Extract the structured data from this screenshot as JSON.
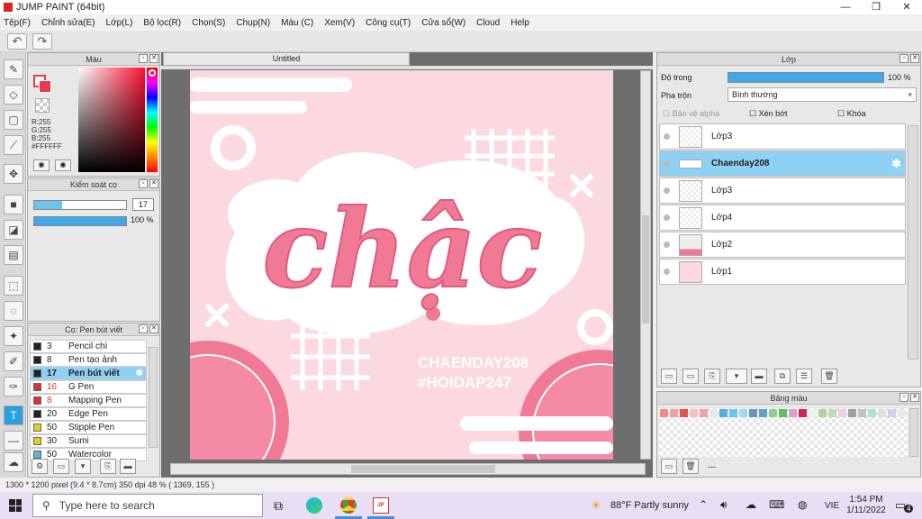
{
  "app": {
    "title": "JUMP PAINT (64bit)"
  },
  "window_controls": {
    "minimize": "—",
    "maximize": "❐",
    "close": "✕"
  },
  "menu": [
    "Tệp(F)",
    "Chỉnh sửa(E)",
    "Lớp(L)",
    "Bộ lọc(R)",
    "Chọn(S)",
    "Chụp(N)",
    "Màu (C)",
    "Xem(V)",
    "Công cụ(T)",
    "Cửa sổ(W)",
    "Cloud",
    "Help"
  ],
  "toolbar": {
    "undo": "↶",
    "redo": "↷"
  },
  "color_panel": {
    "title": "Màu",
    "r": "R:255",
    "g": "G:255",
    "b": "B:255",
    "hex": "#FFFFFF"
  },
  "brush_control": {
    "title": "Kiểm soát cọ",
    "size": "17",
    "opacity": "100 %",
    "size_fill": 0.3,
    "opacity_fill": 1.0
  },
  "brush_list": {
    "title": "Cọ: Pen bút viết",
    "items": [
      {
        "num": "3",
        "name": "Pencil chì",
        "color": "#222222"
      },
      {
        "num": "8",
        "name": "Pen tạo ảnh",
        "color": "#222222"
      },
      {
        "num": "17",
        "name": "Pen bút viết",
        "color": "#222222"
      },
      {
        "num": "16",
        "name": "G Pen",
        "color": "#e03030"
      },
      {
        "num": "8",
        "name": "Mapping Pen",
        "color": "#e03030"
      },
      {
        "num": "20",
        "name": "Edge Pen",
        "color": "#222222"
      },
      {
        "num": "50",
        "name": "Stipple Pen",
        "color": "#e0d020"
      },
      {
        "num": "30",
        "name": "Sumi",
        "color": "#e0d020"
      },
      {
        "num": "50",
        "name": "Watercolor",
        "color": "#60b0e0"
      }
    ]
  },
  "canvas": {
    "tab": "Untitled",
    "word": "chậc",
    "watermark1": "CHAENDAY208",
    "watermark2": "#HOIDAP247"
  },
  "layer_panel": {
    "title": "Lớp",
    "opacity_label": "Độ trong",
    "opacity_value": "100 %",
    "opacity_fill": 1.0,
    "blend_label": "Pha trộn",
    "blend_value": "Bình thường",
    "protect_alpha": "Bảo vệ alpha",
    "clip": "Xén bớt",
    "lock": "Khóa",
    "layers": [
      {
        "name": "Lớp3"
      },
      {
        "name": "Chaenday208"
      },
      {
        "name": "Lớp3"
      },
      {
        "name": "Lớp4"
      },
      {
        "name": "Lớp2"
      },
      {
        "name": "Lớp1"
      }
    ]
  },
  "swatch_panel": {
    "title": "Bảng màu",
    "dashes": "---",
    "colors": [
      "#f28a8a",
      "#f4a0a0",
      "#e85050",
      "#f5c2c2",
      "#f0a0b0",
      "#e8e8e8",
      "#50b0e0",
      "#70c0f0",
      "#a0d8f0",
      "#7090c0",
      "#60a0d0",
      "#8fd08f",
      "#60c060",
      "#e0a0c0",
      "#d02060",
      "#f0f0f0",
      "#b0d0a0",
      "#c0e0b0",
      "#f0d0e0",
      "#a0a0a0",
      "#c0c0c0",
      "#b0e0d0",
      "#e0e0e0",
      "#d0d0f0",
      "#e8e8e8"
    ]
  },
  "status": {
    "text": "1300 * 1200 pixel   (9.4 * 8.7cm)   350 dpi   48 %   ( 1369, 155 )"
  },
  "taskbar": {
    "search": "Type here to search",
    "weather": "88°F  Partly sunny",
    "lang": "VIE",
    "time": "1:54 PM",
    "date": "1/11/2022",
    "notif": "4"
  }
}
